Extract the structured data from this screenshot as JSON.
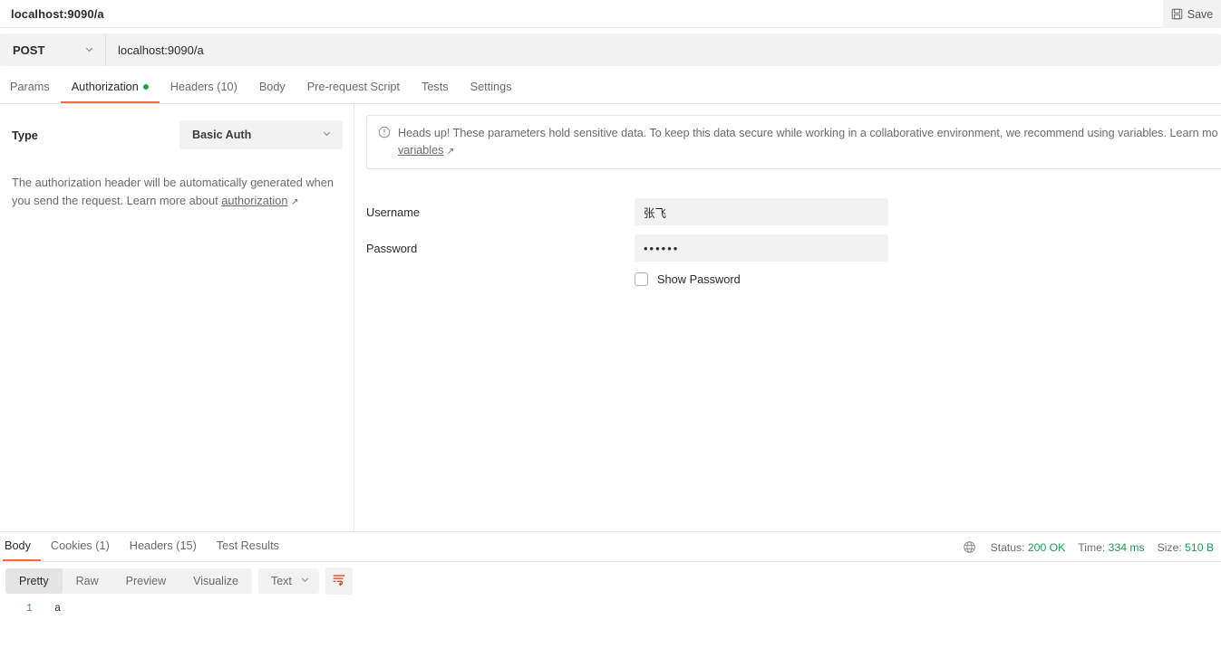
{
  "titlebar": {
    "tab_title": "localhost:9090/a",
    "save_label": "Save",
    "save_icon": "floppy-disk-icon"
  },
  "request": {
    "method": "POST",
    "url": "localhost:9090/a",
    "tabs": [
      {
        "label": "Params",
        "active": false,
        "dot": false
      },
      {
        "label": "Authorization",
        "active": true,
        "dot": true
      },
      {
        "label": "Headers (10)",
        "active": false,
        "dot": false
      },
      {
        "label": "Body",
        "active": false,
        "dot": false
      },
      {
        "label": "Pre-request Script",
        "active": false,
        "dot": false
      },
      {
        "label": "Tests",
        "active": false,
        "dot": false
      },
      {
        "label": "Settings",
        "active": false,
        "dot": false
      }
    ]
  },
  "auth": {
    "type_label": "Type",
    "type_value": "Basic Auth",
    "help_text": "The authorization header will be automatically generated when you send the request. Learn more about ",
    "help_link": "authorization",
    "notice_text": "Heads up! These parameters hold sensitive data. To keep this data secure while working in a collaborative environment, we recommend using variables. Learn mo",
    "notice_link": "variables",
    "username_label": "Username",
    "username_value": "张飞",
    "password_label": "Password",
    "password_value": "••••••",
    "show_password_label": "Show Password",
    "show_password_checked": false
  },
  "response": {
    "tabs": [
      {
        "label": "Body",
        "active": true
      },
      {
        "label": "Cookies (1)",
        "active": false
      },
      {
        "label": "Headers (15)",
        "active": false
      },
      {
        "label": "Test Results",
        "active": false
      }
    ],
    "status_label": "Status:",
    "status_value": "200 OK",
    "time_label": "Time:",
    "time_value": "334 ms",
    "size_label": "Size:",
    "size_value": "510 B",
    "format_tabs": [
      {
        "label": "Pretty",
        "active": true
      },
      {
        "label": "Raw",
        "active": false
      },
      {
        "label": "Preview",
        "active": false
      },
      {
        "label": "Visualize",
        "active": false
      }
    ],
    "content_type": "Text",
    "body_lines": [
      {
        "number": "1",
        "text": "a"
      }
    ]
  },
  "colors": {
    "accent": "#ff6c37",
    "success": "#1d9c55",
    "dot": "#25a244",
    "panel": "#f2f2f2"
  }
}
